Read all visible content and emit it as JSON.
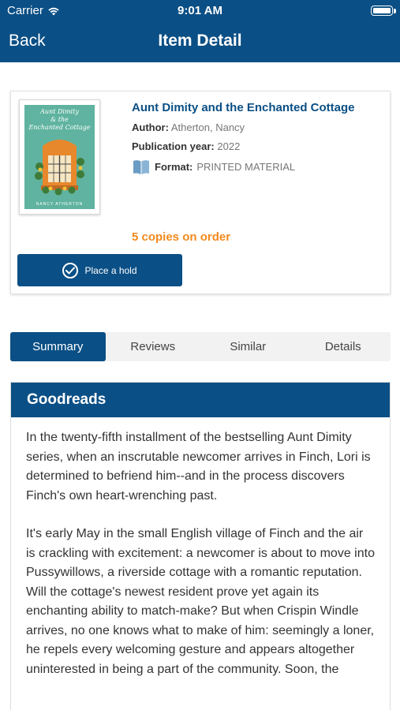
{
  "status_bar": {
    "carrier": "Carrier",
    "time": "9:01 AM"
  },
  "nav": {
    "back_label": "Back",
    "title": "Item Detail"
  },
  "item": {
    "cover": {
      "title_line1": "Aunt Dimity",
      "title_line2": "& the",
      "title_line3": "Enchanted Cottage",
      "author": "NANCY ATHERTON"
    },
    "title": "Aunt Dimity and the Enchanted Cottage",
    "author_label": "Author:",
    "author": "Atherton, Nancy",
    "pubyear_label": "Publication year:",
    "pubyear": "2022",
    "format_label": "Format:",
    "format": "PRINTED MATERIAL",
    "copies_status": "5 copies on order",
    "hold_button": "Place a hold"
  },
  "tabs": [
    {
      "label": "Summary",
      "active": true
    },
    {
      "label": "Reviews",
      "active": false
    },
    {
      "label": "Similar",
      "active": false
    },
    {
      "label": "Details",
      "active": false
    }
  ],
  "summary": {
    "source": "Goodreads",
    "paragraphs": [
      "In the twenty-fifth installment of the bestselling Aunt Dimity series, when an inscrutable newcomer arrives in Finch, Lori is determined to befriend him--and in the process discovers Finch's own heart-wrenching past.",
      "It's early May in the small English village of Finch and the air is crackling with excitement: a newcomer is about to move into Pussywillows, a riverside cottage with a romantic reputation. Will the cottage's newest resident prove yet again its enchanting ability to match-make? But when Crispin Windle arrives, no one knows what to make of him: seemingly a loner, he repels every welcoming gesture and appears altogether uninterested in being a part of the community. Soon, the"
    ]
  },
  "colors": {
    "primary": "#0a4f85",
    "accent": "#f28a1e",
    "tab_bg": "#f2f2f2",
    "cover": "#5fb3a0"
  },
  "icons": {
    "wifi": "wifi-icon",
    "battery": "battery-icon",
    "book": "book-icon",
    "check": "check-circle-icon"
  }
}
